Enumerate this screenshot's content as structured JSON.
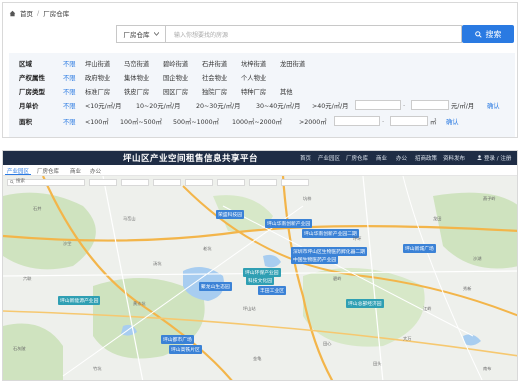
{
  "breadcrumb": {
    "home": "首页",
    "current": "厂房仓库"
  },
  "search": {
    "type": "厂房仓库",
    "placeholder": "输入你想要找的房源",
    "button": "搜索"
  },
  "filters": {
    "district": {
      "label": "区域",
      "options": [
        "不限",
        "坪山街道",
        "马峦街道",
        "碧岭街道",
        "石井街道",
        "坑梓街道",
        "龙田街道"
      ]
    },
    "property": {
      "label": "产权属性",
      "options": [
        "不限",
        "政府物业",
        "集体物业",
        "国企物业",
        "社会物业",
        "个人物业"
      ]
    },
    "type": {
      "label": "厂房类型",
      "options": [
        "不限",
        "标准厂房",
        "铁皮厂房",
        "园区厂房",
        "独院厂房",
        "特种厂房",
        "其他"
      ]
    },
    "rent": {
      "label": "月单价",
      "options": [
        "不限",
        "<10元/㎡/月",
        "10~20元/㎡/月",
        "20~30元/㎡/月",
        "30~40元/㎡/月",
        ">40元/㎡/月"
      ],
      "unit": "元/㎡/月",
      "confirm": "确认"
    },
    "area": {
      "label": "面积",
      "options": [
        "不限",
        "<100㎡",
        "100㎡~500㎡",
        "500㎡~1000㎡",
        "1000㎡~2000㎡",
        ">2000㎡"
      ],
      "unit": "㎡",
      "confirm": "确认"
    }
  },
  "platform": {
    "title": "坪山区产业空间租售信息共享平台",
    "nav": [
      "首页",
      "产业园区",
      "厂房仓库",
      "商业",
      "办公",
      "招商政策",
      "资料发布"
    ],
    "login": "登录 / 注册",
    "tabs": [
      "产业园区",
      "厂房仓库",
      "商业",
      "办公"
    ],
    "map_search": "搜索",
    "map_labels": [
      "荣盛科技园",
      "坪山华南创新产业园",
      "坪山华南创新产业园二期",
      "深圳市坪山区生物医药孵化器二期",
      "中国生物医药产业园",
      "坪山环保产业园",
      "科技文化园",
      "聚龙山生态园",
      "丰田工业区",
      "坪山都市广场",
      "坪山高铁片区",
      "坪山总部经济园",
      "坪山新城广场",
      "坪山新能源产业园"
    ],
    "places": [
      "石井",
      "马峦山",
      "坑梓",
      "龙田",
      "碧岭",
      "汤坑",
      "沙湖",
      "六联",
      "江岭",
      "竹坑",
      "金龟",
      "田头",
      "南布",
      "沙坣",
      "老坑",
      "坪环",
      "秀新",
      "坪山站",
      "石灰陂",
      "大万",
      "黄沙坑",
      "田心",
      "燕子岭"
    ],
    "colors": {
      "bar": "#1f2d45",
      "accent": "#2a7ae2",
      "marker": "#3b82d6",
      "water": "#a8cdf0",
      "green": "#cfe3bf",
      "highway": "#f3b54a"
    }
  }
}
